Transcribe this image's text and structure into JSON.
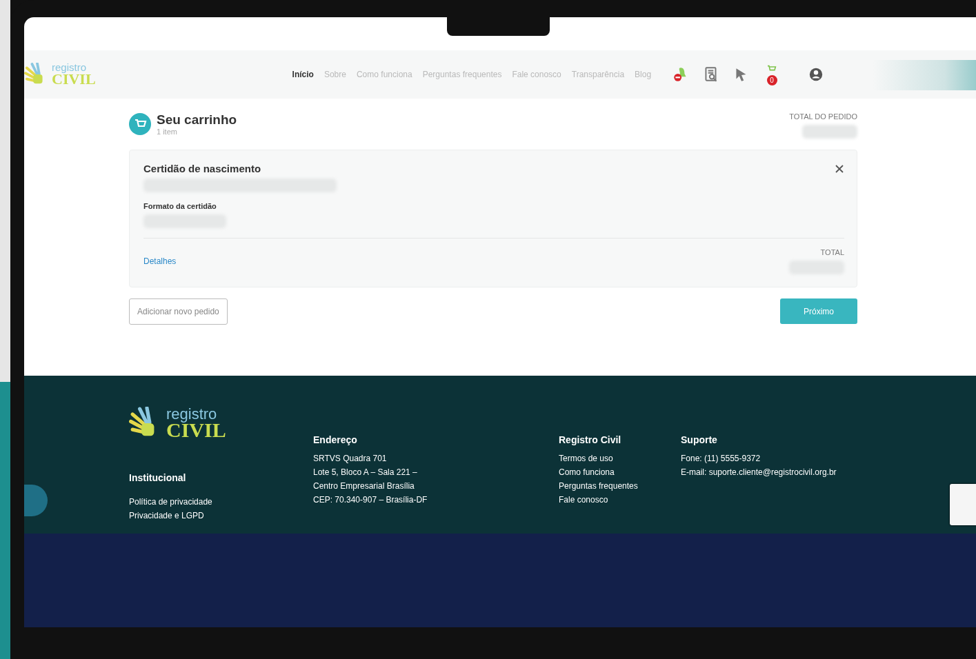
{
  "header": {
    "logo": {
      "top": "registro",
      "bottom": "CIVIL"
    },
    "nav": [
      {
        "label": "Início",
        "selected": true
      },
      {
        "label": "Sobre",
        "selected": false
      },
      {
        "label": "Como funciona",
        "selected": false
      },
      {
        "label": "Perguntas frequentes",
        "selected": false
      },
      {
        "label": "Fale conosco",
        "selected": false
      },
      {
        "label": "Transparência",
        "selected": false
      },
      {
        "label": "Blog",
        "selected": false
      }
    ],
    "cart_badge": "0"
  },
  "cart": {
    "title": "Seu carrinho",
    "count": "1 item",
    "total_label": "TOTAL DO PEDIDO",
    "item": {
      "name": "Certidão de nascimento",
      "format_label": "Formato da certidão",
      "details_link": "Detalhes",
      "total_label": "TOTAL"
    },
    "add_button": "Adicionar novo pedido",
    "next_button": "Próximo"
  },
  "footer": {
    "logo": {
      "top": "registro",
      "bottom": "CIVIL"
    },
    "columns": [
      {
        "heading": "Institucional",
        "lines": [
          "Política de privacidade",
          "Privacidade e LGPD"
        ]
      },
      {
        "heading": "Endereço",
        "lines": [
          "SRTVS Quadra 701",
          "Lote 5, Bloco A – Sala 221 –",
          "Centro Empresarial Brasília",
          "CEP: 70.340-907 – Brasília-DF"
        ]
      },
      {
        "heading": "Registro Civil",
        "lines": [
          "Termos de uso",
          "Como funciona",
          "Perguntas frequentes",
          "Fale conosco"
        ]
      },
      {
        "heading": "Suporte",
        "lines": [
          "Fone: (11) 5555-9372",
          "E-mail: suporte.cliente@registrocivil.org.br"
        ]
      }
    ]
  }
}
